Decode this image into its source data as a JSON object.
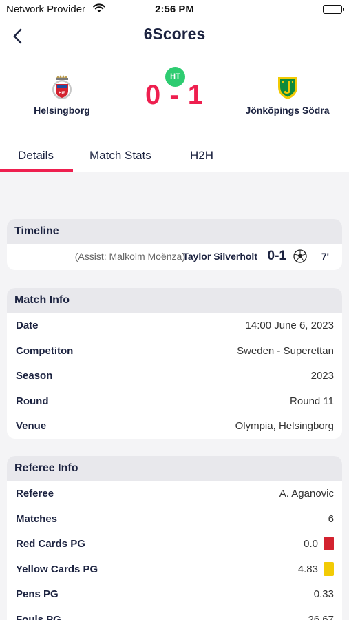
{
  "status_bar": {
    "provider": "Network Provider",
    "time": "2:56 PM"
  },
  "nav": {
    "title": "6Scores"
  },
  "match": {
    "home": {
      "name": "Helsingborg"
    },
    "away": {
      "name": "Jönköpings Södra"
    },
    "status": "HT",
    "score": "0 - 1"
  },
  "tabs": [
    {
      "label": "Details",
      "active": true
    },
    {
      "label": "Match Stats",
      "active": false
    },
    {
      "label": "H2H",
      "active": false
    }
  ],
  "timeline": {
    "title": "Timeline",
    "events": [
      {
        "assist": "(Assist: Malkolm Moënza)",
        "player": "Taylor Silverholt",
        "score": "0-1",
        "icon": "soccer-ball-icon",
        "minute": "7'"
      }
    ]
  },
  "match_info": {
    "title": "Match Info",
    "rows": [
      {
        "label": "Date",
        "value": "14:00 June 6, 2023"
      },
      {
        "label": "Competiton",
        "value": "Sweden - Superettan"
      },
      {
        "label": "Season",
        "value": "2023"
      },
      {
        "label": "Round",
        "value": "Round 11"
      },
      {
        "label": "Venue",
        "value": "Olympia, Helsingborg"
      }
    ]
  },
  "referee_info": {
    "title": "Referee Info",
    "rows": [
      {
        "label": "Referee",
        "value": "A. Aganovic"
      },
      {
        "label": "Matches",
        "value": "6"
      },
      {
        "label": "Red Cards PG",
        "value": "0.0",
        "card_color": "#d3222f"
      },
      {
        "label": "Yellow Cards PG",
        "value": "4.83",
        "card_color": "#f2cb05"
      },
      {
        "label": "Pens PG",
        "value": "0.33"
      },
      {
        "label": "Fouls PG",
        "value": "26.67"
      }
    ]
  },
  "colors": {
    "accent": "#ee1f4f",
    "ht_badge": "#2ecc71",
    "navy": "#1c2340"
  }
}
